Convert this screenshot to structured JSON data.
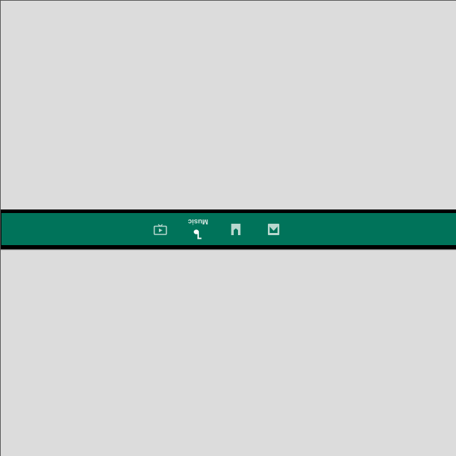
{
  "bottom_nav": {
    "items": [
      {
        "id": "movies",
        "label": "",
        "icon": "tv-play-icon",
        "active": false
      },
      {
        "id": "music",
        "label": "Music",
        "icon": "music-note-icon",
        "active": true
      },
      {
        "id": "books",
        "label": "",
        "icon": "book-icon",
        "active": false
      },
      {
        "id": "photos",
        "label": "",
        "icon": "photo-icon",
        "active": false
      }
    ]
  },
  "colors": {
    "background": "#dcdcdc",
    "nav_background": "#00735a",
    "icon": "#b9d8cf",
    "active_icon": "#ffffff"
  }
}
